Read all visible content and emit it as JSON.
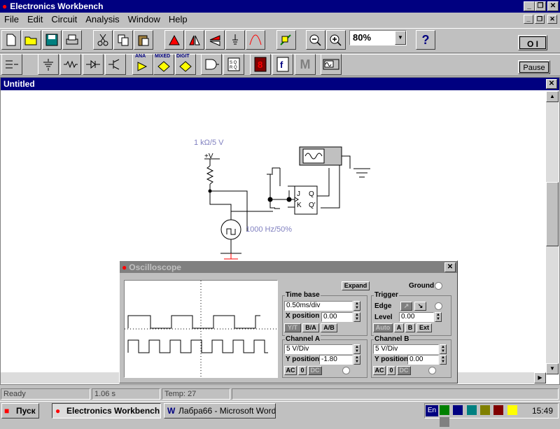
{
  "app": {
    "title": "Electronics Workbench",
    "menu": [
      "File",
      "Edit",
      "Circuit",
      "Analysis",
      "Window",
      "Help"
    ],
    "zoom": "80%",
    "power_switch": "O I",
    "pause_label": "Pause"
  },
  "parts_bin": {
    "ana": "ANA",
    "mixed": "MIXED",
    "digit": "DIGIT",
    "m": "M"
  },
  "circuit_window": {
    "title": "Untitled",
    "labels": {
      "resistor": "1 kΩ/5 V",
      "vcc": "+V",
      "clock": "1000 Hz/50%",
      "ff_j": "J",
      "ff_k": "K",
      "ff_q": "Q",
      "ff_qn": "Q'"
    }
  },
  "oscilloscope": {
    "title": "Oscilloscope",
    "expand_label": "Expand",
    "ground_label": "Ground",
    "time_base": {
      "heading": "Time base",
      "value": "0.50ms/div",
      "x_position_label": "X position",
      "x_position": "0.00",
      "modes": [
        "Y/T",
        "B/A",
        "A/B"
      ]
    },
    "trigger": {
      "heading": "Trigger",
      "edge_label": "Edge",
      "level_label": "Level",
      "level": "0.00",
      "modes": [
        "Auto",
        "A",
        "B",
        "Ext"
      ]
    },
    "channel_a": {
      "heading": "Channel A",
      "scale": "5  V/Div",
      "y_position_label": "Y position",
      "y_position": "-1.80",
      "coupling": [
        "AC",
        "0",
        "DC"
      ]
    },
    "channel_b": {
      "heading": "Channel B",
      "scale": "5  V/Div",
      "y_position_label": "Y position",
      "y_position": "0.00",
      "coupling": [
        "AC",
        "0",
        "DC"
      ]
    }
  },
  "status_bar": {
    "status": "Ready",
    "time": "1.06 s",
    "temp": "Temp:  27"
  },
  "taskbar": {
    "start": "Пуск",
    "tasks": [
      "Electronics Workbench",
      "Лабра66 - Microsoft Word"
    ],
    "lang": "En",
    "clock": "15:49"
  },
  "colors": {
    "titlebar": "#000080",
    "face": "#c0c0c0",
    "label_blue": "#8080c0"
  }
}
